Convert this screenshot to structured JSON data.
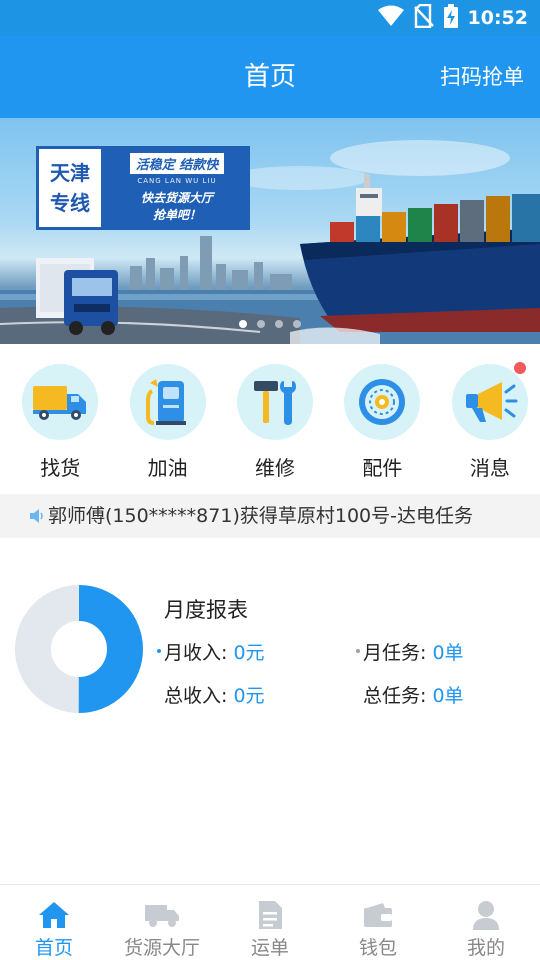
{
  "status_bar": {
    "time": "10:52",
    "icons": [
      "wifi-icon",
      "no-sim-icon",
      "battery-charging-icon"
    ]
  },
  "header": {
    "title": "首页",
    "scan_label": "扫码抢单"
  },
  "banner": {
    "badge_lines": [
      "天津",
      "专线"
    ],
    "slogan_main": "活稳定  结款快",
    "slogan_pinyin": "CANG LAN WU LIU",
    "slogan_sub_lines": [
      "快去货源大厅",
      "抢单吧！"
    ],
    "slide_count": 4,
    "active_slide": 0
  },
  "quick_menu": [
    {
      "label": "找货",
      "icon": "truck-icon",
      "has_badge": false
    },
    {
      "label": "加油",
      "icon": "fuel-pump-icon",
      "has_badge": false
    },
    {
      "label": "维修",
      "icon": "repair-tools-icon",
      "has_badge": false
    },
    {
      "label": "配件",
      "icon": "gear-part-icon",
      "has_badge": false
    },
    {
      "label": "消息",
      "icon": "megaphone-icon",
      "has_badge": true
    }
  ],
  "notice": {
    "icon": "speaker-icon",
    "text": "郭师傅(150*****871)获得草原村100号-达电任务"
  },
  "report": {
    "title": "月度报表",
    "monthly_income_label": "月收入:",
    "monthly_income_value": "0元",
    "monthly_tasks_label": "月任务:",
    "monthly_tasks_value": "0单",
    "total_income_label": "总收入:",
    "total_income_value": "0元",
    "total_tasks_label": "总任务:",
    "total_tasks_value": "0单",
    "donut_share": 0.5,
    "colors": {
      "primary": "#2196f0",
      "track": "#e3e8ee"
    }
  },
  "bottom_nav": [
    {
      "label": "首页",
      "icon": "home-icon",
      "active": true
    },
    {
      "label": "货源大厅",
      "icon": "cargo-truck-icon",
      "active": false
    },
    {
      "label": "运单",
      "icon": "document-icon",
      "active": false
    },
    {
      "label": "钱包",
      "icon": "wallet-icon",
      "active": false
    },
    {
      "label": "我的",
      "icon": "user-icon",
      "active": false
    }
  ],
  "colors": {
    "brand": "#2196f0",
    "status_bar": "#1d94e4",
    "badge": "#f25a5a",
    "icon_bg": "#d7f3f7"
  }
}
